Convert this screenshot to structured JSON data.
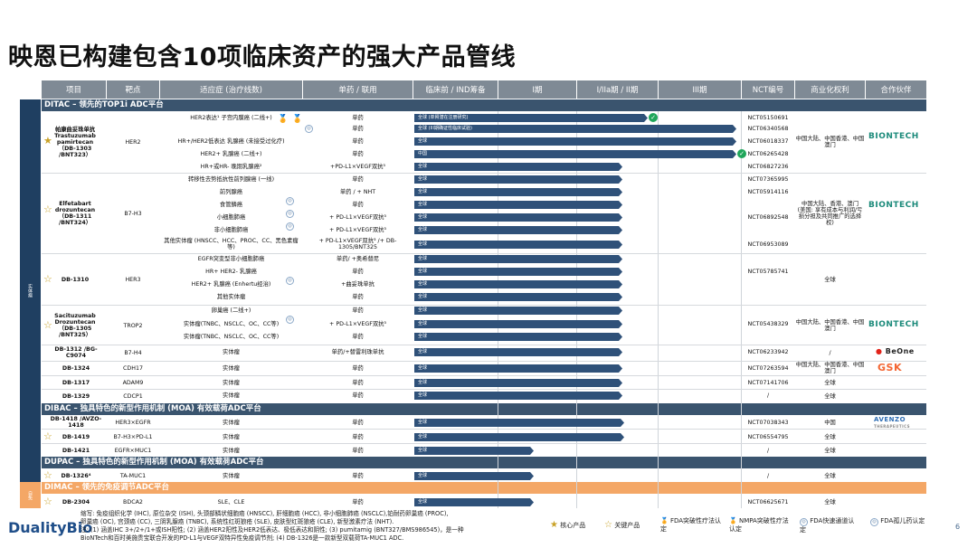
{
  "title": "映恩已构建包含10项临床资产的强大产品管线",
  "headers": [
    "项目",
    "靶点",
    "适应症 (治疗线数)",
    "单药 / 联用",
    "临床前 / IND筹备",
    "I期",
    "I/IIa期 / II期",
    "III期",
    "NCT编号",
    "商业化权利",
    "合作伙伴"
  ],
  "sections": {
    "ditac": "DITAC – 领先的TOP1i ADC平台",
    "dibac": "DIBAC – 独具特色的新型作用机制 (MOA) 有效载荷ADC平台",
    "dupac": "DUPAC – 独具特色的新型作用机制 (MOA) 有效载荷ADC平台",
    "dimac": "DIMAC – 领先的免疫调节ADC平台",
    "side_top": "实体瘤",
    "side_bottom": "自免"
  },
  "assets": {
    "a1": "帕康曲妥珠单抗\nTrastuzumab pamirtecan\n（DB-1303 /BNT323）",
    "a2": "Elfetabart drozuntecan\n（DB-1311 /BNT324）",
    "a3": "DB-1310",
    "a4": "Sacituzumab Drozuntecan\n（DB-1305 /BNT325）",
    "a5": "DB-1312 /BG-C9074",
    "a6": "DB-1324",
    "a7": "DB-1317",
    "a8": "DB-1329",
    "a9": "DB-1418 /AVZO-1418",
    "a10": "DB-1419",
    "a11": "DB-1421",
    "a12": "DB-1326⁴",
    "a13": "DB-2304"
  },
  "targets": {
    "a1": "HER2",
    "a2": "B7-H3",
    "a3": "HER3",
    "a4": "TROP2",
    "a5": "B7-H4",
    "a6": "CDH17",
    "a7": "ADAM9",
    "a8": "CDCP1",
    "a9": "HER3×EGFR",
    "a10": "B7-H3×PD-L1",
    "a11": "EGFR×MUC1",
    "a12": "TA-MUC1",
    "a13": "BDCA2"
  },
  "rows": [
    {
      "ind": "HER2表达¹ 子宫内膜癌 (二线+)",
      "mono": "单药",
      "nct": "NCT05150691",
      "bar": "全球 (单臂潜在注册研究)"
    },
    {
      "ind": "",
      "mono": "单药",
      "nct": "NCT06340568",
      "bar": "全球 (III期确证性临床试验)"
    },
    {
      "ind": "HR+/HER2低表达 乳腺癌 (未接受过化疗)",
      "mono": "单药",
      "nct": "NCT06018337",
      "bar": "全球"
    },
    {
      "ind": "HER2+ 乳腺癌 (二线+)",
      "mono": "单药",
      "nct": "NCT06265428",
      "bar": "中国"
    },
    {
      "ind": "HR+或HR- 晚期乳腺癌²",
      "mono": "+PD-L1×VEGF双抗³",
      "nct": "NCT06827236",
      "bar": "全球"
    },
    {
      "ind": "转移性去势抵抗性前列腺癌 (一线)",
      "mono": "单药",
      "nct": "NCT07365995",
      "bar": "全球"
    },
    {
      "ind": "前列腺癌",
      "mono": "单药 / + NHT",
      "nct": "NCT05914116",
      "bar": "全球"
    },
    {
      "ind": "食管鳞癌",
      "mono": "单药",
      "nct": "",
      "bar": "全球"
    },
    {
      "ind": "小细胞肺癌",
      "mono": "+ PD-L1×VEGF双抗³",
      "nct": "NCT06892548",
      "bar": "全球"
    },
    {
      "ind": "非小细胞肺癌",
      "mono": "+ PD-L1×VEGF双抗³",
      "nct": "",
      "bar": "全球"
    },
    {
      "ind": "其他实体瘤 (HNSCC、HCC、PROC、CC、黑色素瘤等)",
      "mono": "+ PD-L1×VEGF双抗³ /+ DB-1305/BNT325",
      "nct": "NCT06953089",
      "bar": "全球"
    },
    {
      "ind": "EGFR突变型非小细胞肺癌",
      "mono": "单药/ +奥希替尼",
      "nct": "",
      "bar": "全球"
    },
    {
      "ind": "HR+ HER2- 乳腺癌",
      "mono": "单药",
      "nct": "NCT05785741",
      "bar": "全球"
    },
    {
      "ind": "HER2+ 乳腺癌 (Enhertu经治)",
      "mono": "+曲妥珠单抗",
      "nct": "",
      "bar": "全球"
    },
    {
      "ind": "其他实体瘤",
      "mono": "单药",
      "nct": "",
      "bar": "全球"
    },
    {
      "ind": "卵巢癌 (二线+)",
      "mono": "单药",
      "nct": "",
      "bar": "全球"
    },
    {
      "ind": "实体瘤(TNBC、NSCLC、OC、CC等)",
      "mono": "+ PD-L1×VEGF双抗³",
      "nct": "NCT05438329",
      "bar": "全球"
    },
    {
      "ind": "实体瘤(TNBC、NSCLC、OC、CC等)",
      "mono": "单药",
      "nct": "",
      "bar": "全球"
    },
    {
      "ind": "实体瘤",
      "mono": "单药/+替雷利珠单抗",
      "nct": "NCT06233942",
      "bar": "全球"
    },
    {
      "ind": "实体瘤",
      "mono": "单药",
      "nct": "NCT07263594",
      "bar": "全球"
    },
    {
      "ind": "实体瘤",
      "mono": "单药",
      "nct": "NCT07141706",
      "bar": "全球"
    },
    {
      "ind": "实体瘤",
      "mono": "单药",
      "nct": "/",
      "bar": "全球"
    },
    {
      "ind": "实体瘤",
      "mono": "单药",
      "nct": "NCT07038343",
      "bar": "全球"
    },
    {
      "ind": "实体瘤",
      "mono": "单药",
      "nct": "NCT06554795",
      "bar": "全球"
    },
    {
      "ind": "实体瘤",
      "mono": "单药",
      "nct": "/",
      "bar": "全球"
    },
    {
      "ind": "实体瘤",
      "mono": "单药",
      "nct": "/",
      "bar": "全球"
    },
    {
      "ind": "SLE、CLE",
      "mono": "单药",
      "nct": "NCT06625671",
      "bar": "全球"
    }
  ],
  "rights": {
    "a1": "中国大陆、中国香港、中国澳门",
    "a2": "中国大陆、香港、澳门\n(美国: 享有成本与利润/亏损分担及共同推广的选择权)",
    "a3": "全球",
    "a4": "中国大陆、中国香港、中国澳门",
    "a5": "/",
    "a6": "中国大陆、中国香港、中国澳门",
    "a7": "全球",
    "a8": "全球",
    "a9": "中国",
    "a10": "全球",
    "a11": "全球",
    "a12": "全球",
    "a13": "全球"
  },
  "partners": {
    "biontech": "BIONTECH",
    "beone": "BeOne",
    "gsk": "GSK",
    "avenzo": "AVENZO",
    "avenzo_sub": "THERAPEUTICS"
  },
  "brand": "DualityBio",
  "legend": {
    "core": "核心产品",
    "key": "关键产品",
    "fda_btd": "FDA突破性疗法认定",
    "nmpa_btd": "NMPA突破性疗法认定",
    "fda_ft": "FDA快速通道认定",
    "fda_od": "FDA孤儿药认定"
  },
  "footnotes": [
    "缩写: 免疫组织化学 (IHC), 原位杂交 (ISH), 头颈部鳞状细胞癌 (HNSCC), 肝细胞癌 (HCC), 非小细胞肺癌 (NSCLC),铂耐药卵巢癌 (PROC),",
    "卵巢癌 (OC), 宫颈癌 (CC), 三阴乳腺癌 (TNBC), 系统性红斑狼疮 (SLE), 皮肤型红斑狼疮 (CLE), 新型激素疗法 (NHT).",
    "注: (1) 涵盖IHC 3+/2+/1+或ISH阳性; (2) 涵盖HER2阳性及HER2低表达、极低表达和阴性; (3) pumitamig (BNT327/BMS986545)，是一种",
    "BioNTech和百时美施贵宝联合开发的PD-L1与VEGF双特异性免疫调节剂; (4) DB-1326是一款新型双载荷TA-MUC1 ADC."
  ],
  "page_number": "6",
  "colors": {
    "navy": "#1f3f61",
    "header": "#7f8a95",
    "section": "#3a546e",
    "orange": "#f4a766",
    "gold": "#c9a227",
    "green": "#1fa65a"
  }
}
